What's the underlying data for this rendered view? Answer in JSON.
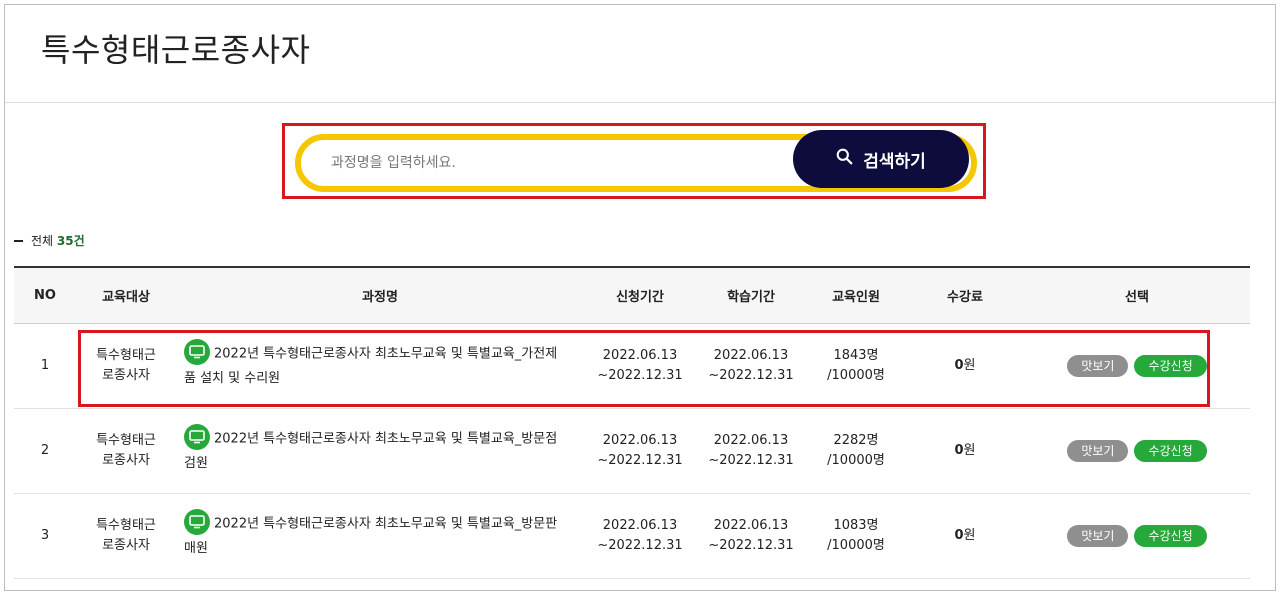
{
  "page": {
    "title": "특수형태근로종사자"
  },
  "search": {
    "placeholder": "과정명을 입력하세요.",
    "button_label": "검색하기"
  },
  "summary": {
    "prefix": "전체",
    "count": "35",
    "suffix": "건"
  },
  "table": {
    "headers": [
      "NO",
      "교육대상",
      "과정명",
      "신청기간",
      "학습기간",
      "교육인원",
      "수강료",
      "선택"
    ],
    "rows": [
      {
        "no": "1",
        "target_line1": "특수형태근",
        "target_line2": "로종사자",
        "course": "2022년 특수형태근로종사자 최초노무교육 및 특별교육_가전제품 설치 및 수리원",
        "apply_start": "2022.06.13",
        "apply_end": "~2022.12.31",
        "study_start": "2022.06.13",
        "study_end": "~2022.12.31",
        "enrolled": "1843명",
        "capacity": "/10000명",
        "fee_value": "0",
        "fee_unit": "원",
        "preview_label": "맛보기",
        "apply_label": "수강신청"
      },
      {
        "no": "2",
        "target_line1": "특수형태근",
        "target_line2": "로종사자",
        "course": "2022년 특수형태근로종사자 최초노무교육 및 특별교육_방문점검원",
        "apply_start": "2022.06.13",
        "apply_end": "~2022.12.31",
        "study_start": "2022.06.13",
        "study_end": "~2022.12.31",
        "enrolled": "2282명",
        "capacity": "/10000명",
        "fee_value": "0",
        "fee_unit": "원",
        "preview_label": "맛보기",
        "apply_label": "수강신청"
      },
      {
        "no": "3",
        "target_line1": "특수형태근",
        "target_line2": "로종사자",
        "course": "2022년 특수형태근로종사자 최초노무교육 및 특별교육_방문판매원",
        "apply_start": "2022.06.13",
        "apply_end": "~2022.12.31",
        "study_start": "2022.06.13",
        "study_end": "~2022.12.31",
        "enrolled": "1083명",
        "capacity": "/10000명",
        "fee_value": "0",
        "fee_unit": "원",
        "preview_label": "맛보기",
        "apply_label": "수강신청"
      }
    ]
  },
  "colors": {
    "accent_yellow": "#f4c700",
    "search_button": "#0e0b3d",
    "apply_green": "#27a83a",
    "preview_gray": "#8f8f8f",
    "highlight_red": "#d8161d"
  },
  "icons": {
    "search": "search-icon",
    "course": "monitor-icon"
  }
}
